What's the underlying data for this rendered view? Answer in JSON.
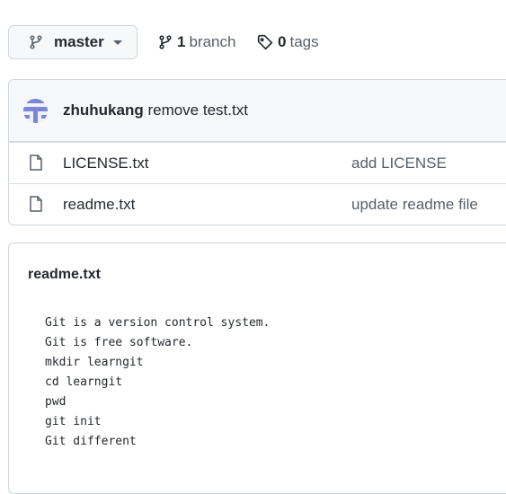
{
  "branch_button": {
    "label": "master",
    "icon": "git-branch-icon"
  },
  "branches": {
    "count": "1",
    "label": "branch"
  },
  "tags": {
    "count": "0",
    "label": "tags"
  },
  "commit": {
    "author": "zhuhukang",
    "message": "remove test.txt"
  },
  "files": [
    {
      "name": "LICENSE.txt",
      "message": "add LICENSE"
    },
    {
      "name": "readme.txt",
      "message": "update readme file"
    }
  ],
  "readme": {
    "title": "readme.txt",
    "lines": [
      "Git is a version control system.",
      "Git is free software.",
      "mkdir learngit",
      "cd learngit",
      "pwd",
      "git init",
      "Git different"
    ]
  }
}
